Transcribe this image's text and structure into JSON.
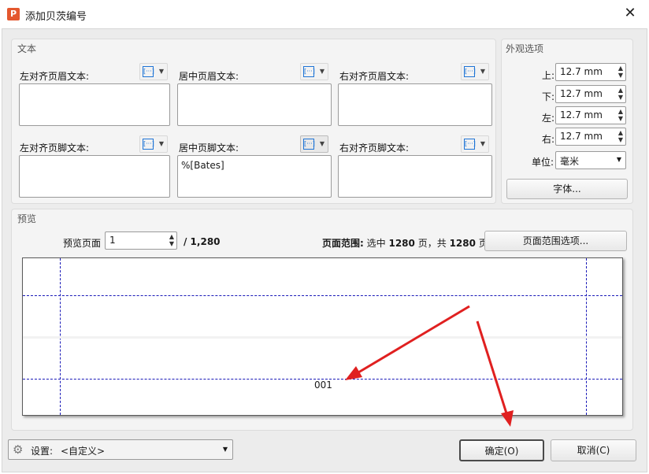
{
  "window": {
    "title": "添加贝茨编号",
    "close_glyph": "✕",
    "app_icon_letter": "P"
  },
  "text_panel": {
    "label": "文本",
    "token_glyph": "[···]",
    "dropdown_glyph": "▼",
    "header_left_label": "左对齐页眉文本:",
    "header_center_label": "居中页眉文本:",
    "header_right_label": "右对齐页眉文本:",
    "footer_left_label": "左对齐页脚文本:",
    "footer_center_label": "居中页脚文本:",
    "footer_right_label": "右对齐页脚文本:",
    "header_left_value": "",
    "header_center_value": "",
    "header_right_value": "",
    "footer_left_value": "",
    "footer_center_value": "%[Bates]",
    "footer_right_value": ""
  },
  "appearance": {
    "label": "外观选项",
    "top_label": "上:",
    "top_value": "12.7 mm",
    "bottom_label": "下:",
    "bottom_value": "12.7 mm",
    "left_label": "左:",
    "left_value": "12.7 mm",
    "right_label": "右:",
    "right_value": "12.7 mm",
    "unit_label": "单位:",
    "unit_value": "毫米",
    "font_button": "字体..."
  },
  "preview": {
    "label": "预览",
    "page_label": "预览页面",
    "page_value": "1",
    "page_total": "/ 1,280",
    "range_label": "页面范围:",
    "range_text_1": "选中",
    "range_selected": "1280",
    "range_text_2": "页，共",
    "range_total": "1280",
    "range_text_3": "页",
    "range_button": "页面范围选项...",
    "bates_sample": "001"
  },
  "footer": {
    "settings_label": "设置:",
    "settings_value": "<自定义>",
    "ok_button": "确定(O)",
    "cancel_button": "取消(C)"
  },
  "colors": {
    "accent": "#1e74d6",
    "guide_line": "#1a1ab8",
    "annotation_arrow": "#e02020",
    "app_icon": "#e4572e"
  }
}
